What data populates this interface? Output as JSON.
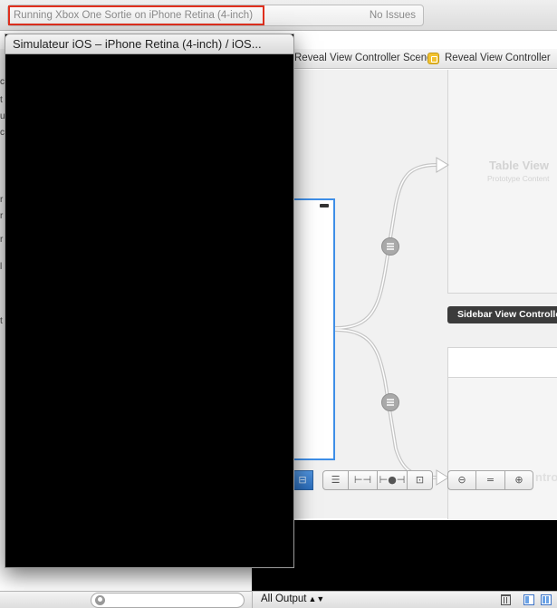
{
  "toolbar": {
    "activity_status": "Running Xbox One Sortie on iPhone Retina (4-inch)",
    "issues_label": "No Issues"
  },
  "jump_bar": {
    "crumb_scene": "Reveal View Controller Scene",
    "separator": "›",
    "crumb_controller": "Reveal View Controller"
  },
  "storyboard": {
    "table_view_title": "Table View",
    "table_view_subtitle": "Prototype Content",
    "sidebar_scene_label": "Sidebar View Controller",
    "front_scene_ghost_text": "ntro"
  },
  "simulator": {
    "window_title": "Simulateur iOS – iPhone Retina (4-inch) / iOS..."
  },
  "left_strip_glyphs": [
    "c",
    "t",
    "u",
    "c",
    "r",
    "r",
    "r",
    "l",
    "t"
  ],
  "zoom_bar": {
    "buttons": [
      {
        "name": "align-button",
        "icon": "⊟"
      },
      {
        "name": "align-left-icon",
        "icon": "☰"
      },
      {
        "name": "pin-icon",
        "icon": "⊢⊣"
      },
      {
        "name": "resolve-icon",
        "icon": "⊢●⊣"
      },
      {
        "name": "resize-icon",
        "icon": "⊡"
      },
      {
        "name": "zoom-out-icon",
        "icon": "⊖"
      },
      {
        "name": "zoom-actual-icon",
        "icon": "="
      },
      {
        "name": "zoom-in-icon",
        "icon": "⊕"
      }
    ]
  },
  "debug_area": {
    "output_filter": "All Output",
    "output_filter_arrows": "▲▼"
  },
  "colors": {
    "activity_highlight": "#e0301e",
    "selection_blue": "#3e8ee7",
    "scene_label_bg": "#3b3b3b"
  }
}
